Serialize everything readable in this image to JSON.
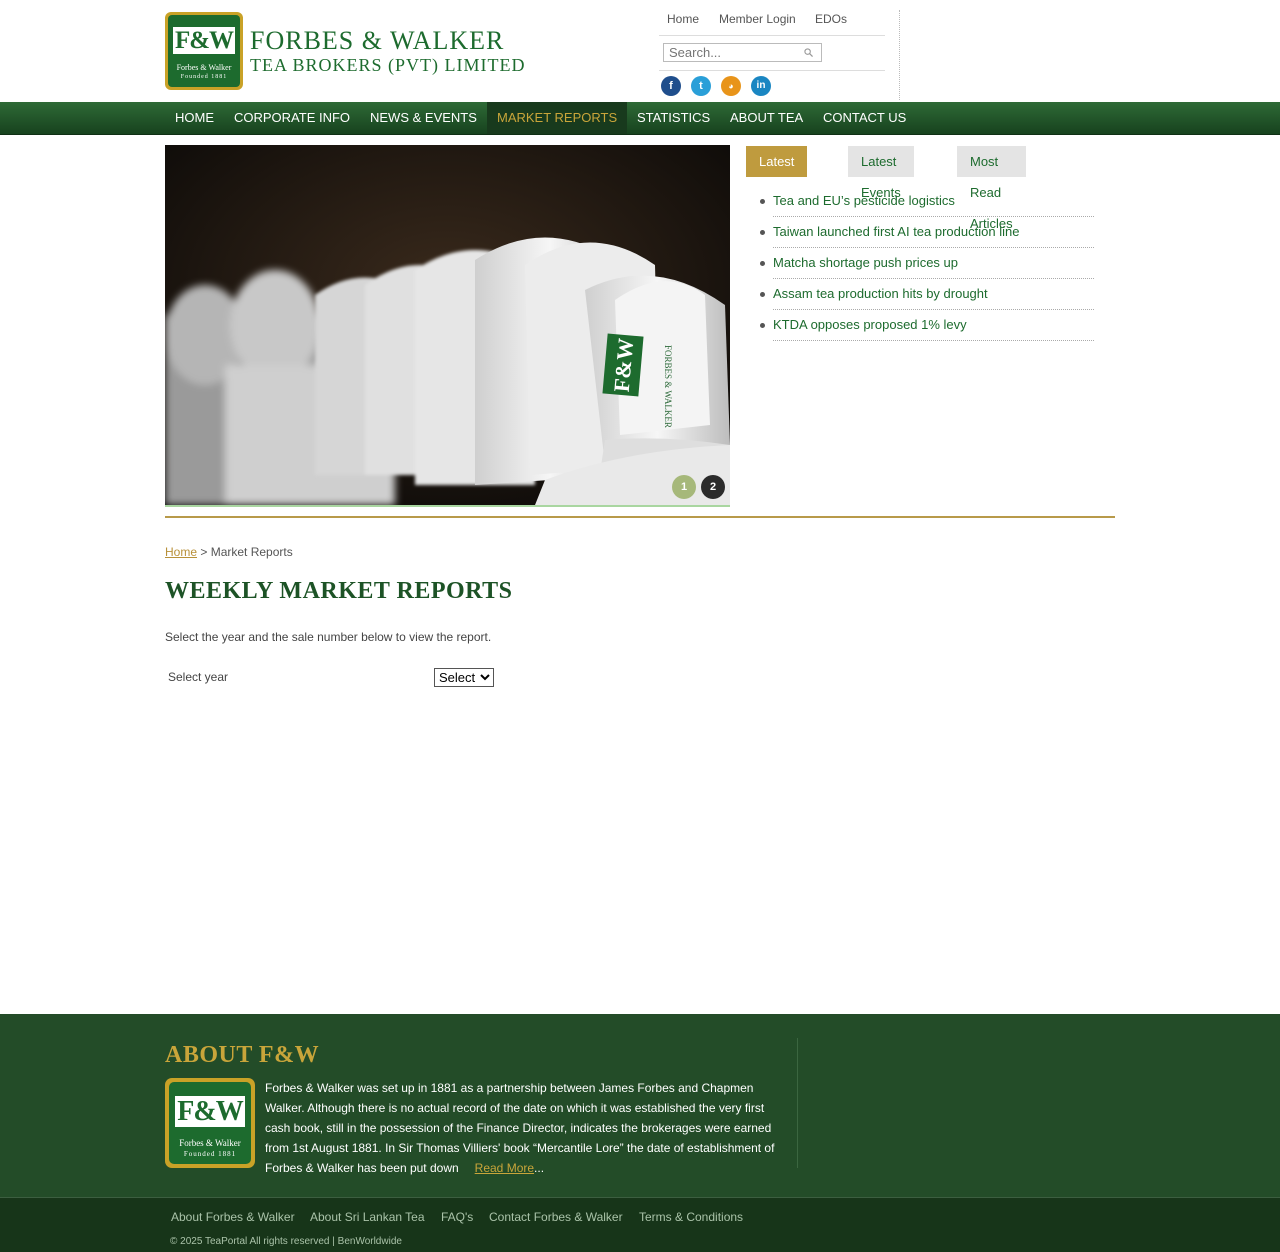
{
  "header": {
    "logo": {
      "mark": "F&W",
      "line1": "Forbes & Walker",
      "line2": "Founded 1881"
    },
    "company_line1": "FORBES & WALKER",
    "company_line2": "TEA BROKERS (PVT) LIMITED",
    "top_links": [
      "Home",
      "Member Login",
      "EDOs"
    ],
    "search_placeholder": "Search...",
    "social": [
      {
        "name": "facebook",
        "glyph": "f",
        "color": "#1f4e8c"
      },
      {
        "name": "twitter",
        "glyph": "t",
        "color": "#2a9fd8"
      },
      {
        "name": "rss",
        "glyph": "◥",
        "color": "#e8941a"
      },
      {
        "name": "linkedin",
        "glyph": "in",
        "color": "#1a86c2"
      }
    ]
  },
  "nav": {
    "items": [
      "HOME",
      "CORPORATE INFO",
      "NEWS & EVENTS",
      "MARKET REPORTS",
      "STATISTICS",
      "ABOUT TEA",
      "CONTACT US"
    ],
    "active": "MARKET REPORTS"
  },
  "slider": {
    "pages": [
      "1",
      "2"
    ],
    "current": "1"
  },
  "tabs": {
    "items": [
      "Latest News",
      "Latest Events",
      "Most Read Articles"
    ],
    "active": "Latest News",
    "news": [
      "Tea and EU’s pesticide logistics",
      "Taiwan launched first AI tea production line",
      "Matcha shortage push prices up",
      "Assam tea production hits by drought",
      "KTDA opposes proposed 1% levy"
    ]
  },
  "main": {
    "breadcrumb_home": "Home",
    "breadcrumb_current": " > Market Reports",
    "title": "WEEKLY MARKET REPORTS",
    "intro": "Select the year and the sale number below to view the report.",
    "year_label": "Select year",
    "year_select_value": "Select"
  },
  "footer": {
    "about_title": "ABOUT F&W",
    "about_text": "Forbes & Walker was set up in 1881 as a partnership between James Forbes and Chapmen Walker. Although there is no actual record of the date on which it was established the very first cash book, still in the possession of the Finance Director, indicates the brokerages were earned from 1st August 1881. In Sir Thomas Villiers' book “Mercantile Lore” the date of establishment of Forbes & Walker has been put down",
    "read_more": "Read More",
    "ellipsis": "...",
    "links": [
      "About Forbes & Walker",
      "About Sri Lankan Tea",
      "FAQ's",
      "Contact Forbes & Walker",
      "Terms & Conditions"
    ],
    "copyright": "©  2025 TeaPortal All rights reserved | BenWorldwide"
  }
}
